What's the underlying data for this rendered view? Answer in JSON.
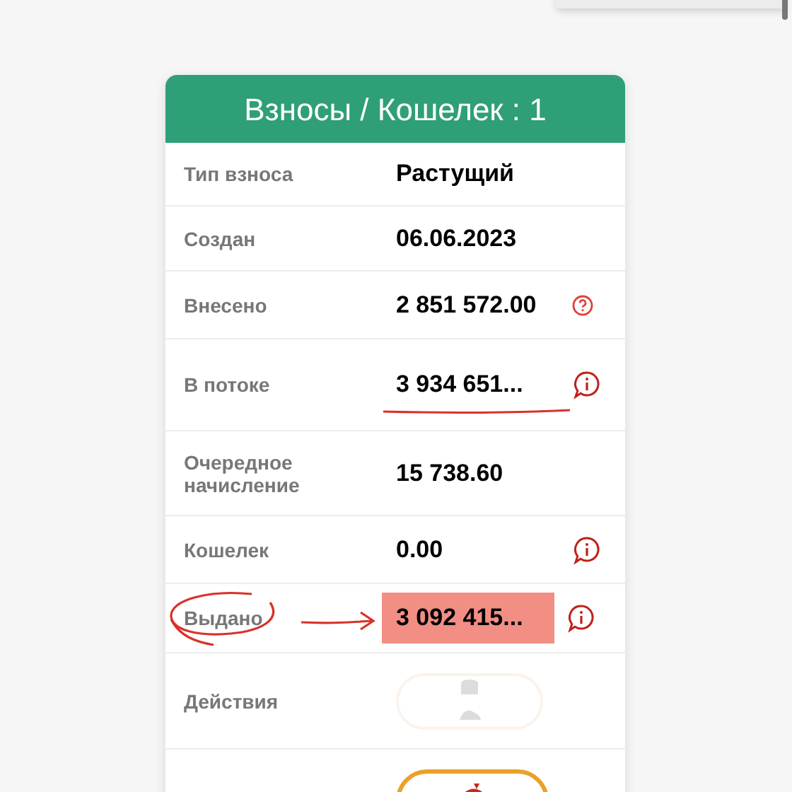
{
  "header": {
    "title": "Взносы / Кошелек : 1"
  },
  "rows": [
    {
      "kind": "plain",
      "label": "Тип взноса",
      "value": "Растущий"
    },
    {
      "kind": "plain",
      "label": "Создан",
      "value": "06.06.2023"
    },
    {
      "kind": "help",
      "label": "Внесено",
      "value": "2 851 572.00"
    },
    {
      "kind": "info",
      "label": "В потоке",
      "value": "3 934 651...",
      "underlined": true
    },
    {
      "kind": "plain",
      "label": "Очередное начисление",
      "value": "15 738.60"
    },
    {
      "kind": "info",
      "label": "Кошелек",
      "value": "0.00"
    },
    {
      "kind": "info",
      "label": "Выдано",
      "value": "3 092 415...",
      "highlighted": true,
      "circled": true
    },
    {
      "kind": "action",
      "label": "Действия",
      "disabled": true
    },
    {
      "kind": "action",
      "disabled": false
    }
  ]
}
